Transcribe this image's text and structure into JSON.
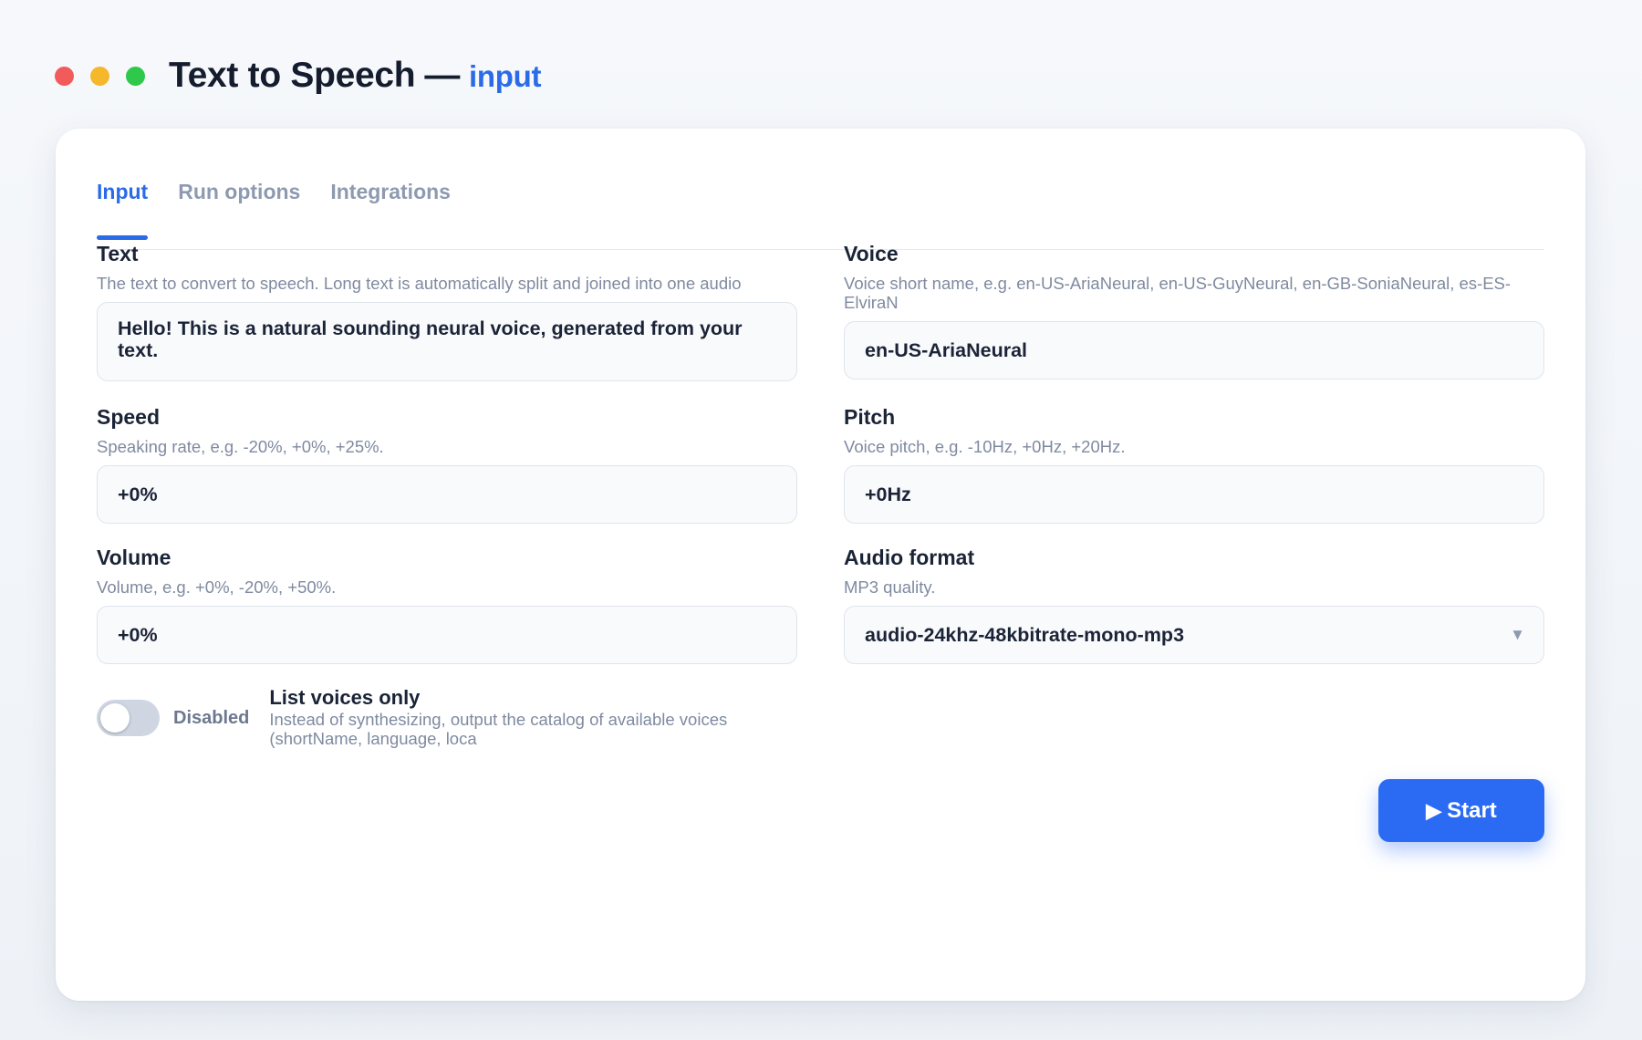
{
  "window": {
    "title": "Text to Speech",
    "separator": "—",
    "subtitle": "input",
    "controls": {
      "close_color": "#f25b5b",
      "minimize_color": "#f5b82a",
      "maximize_color": "#2ec94a"
    }
  },
  "tabs": [
    {
      "label": "Input",
      "active": true
    },
    {
      "label": "Run options",
      "active": false
    },
    {
      "label": "Integrations",
      "active": false
    }
  ],
  "fields": {
    "text": {
      "label": "Text",
      "help": "The text to convert to speech. Long text is automatically split and joined into one audio",
      "value": "Hello! This is a natural sounding neural voice, generated from your text."
    },
    "voice": {
      "label": "Voice",
      "help": "Voice short name, e.g. en-US-AriaNeural, en-US-GuyNeural, en-GB-SoniaNeural, es-ES-ElviraN",
      "value": "en-US-AriaNeural"
    },
    "speed": {
      "label": "Speed",
      "help": "Speaking rate, e.g. -20%, +0%, +25%.",
      "value": "+0%"
    },
    "pitch": {
      "label": "Pitch",
      "help": "Voice pitch, e.g. -10Hz, +0Hz, +20Hz.",
      "value": "+0Hz"
    },
    "volume": {
      "label": "Volume",
      "help": "Volume, e.g. +0%, -20%, +50%.",
      "value": "+0%"
    },
    "audio_format": {
      "label": "Audio format",
      "help": "MP3 quality.",
      "selected": "audio-24khz-48kbitrate-mono-mp3",
      "icon": "chevron-down-icon"
    }
  },
  "list_voices": {
    "enabled": false,
    "state_label": "Disabled",
    "title": "List voices only",
    "help": "Instead of synthesizing, output the catalog of available voices (shortName, language, loca"
  },
  "actions": {
    "start_label": "Start",
    "start_icon": "play-icon",
    "accent_color": "#2b6bf3"
  }
}
